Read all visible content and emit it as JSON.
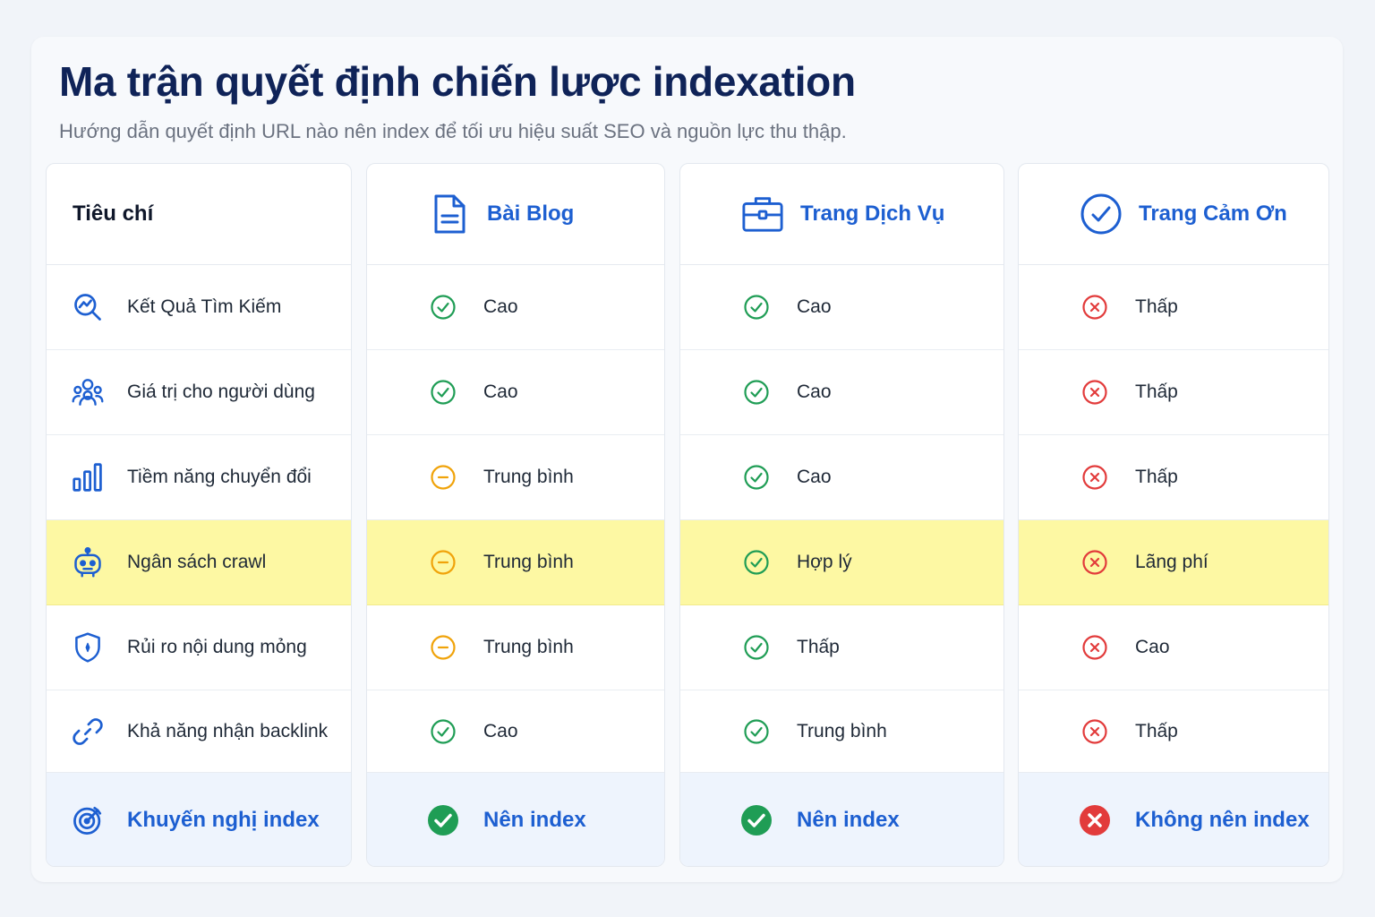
{
  "page": {
    "title": "Ma trận quyết định chiến lược indexation",
    "subtitle": "Hướng dẫn quyết định URL nào nên index để tối ưu hiệu suất SEO và nguồn lực thu thập."
  },
  "colors": {
    "good": "#1f9d55",
    "medium": "#f0a30a",
    "bad": "#e23b3b",
    "accent": "#1d5fd1",
    "highlight": "#fdf8a3",
    "recommend_bg": "#eef4fd"
  },
  "criteria": {
    "header": "Tiêu chí",
    "rows": [
      {
        "label": "Kết Quả Tìm Kiếm",
        "icon": "search-chart-icon"
      },
      {
        "label": "Giá trị cho người dùng",
        "icon": "users-icon"
      },
      {
        "label": "Tiềm năng chuyển đổi",
        "icon": "bar-chart-icon"
      },
      {
        "label": "Ngân sách crawl",
        "icon": "robot-icon"
      },
      {
        "label": "Rủi ro nội dung mỏng",
        "icon": "shield-icon"
      },
      {
        "label": "Khả năng nhận backlink",
        "icon": "link-icon"
      },
      {
        "label": "Khuyến nghị index",
        "icon": "target-icon"
      }
    ]
  },
  "columns": [
    {
      "header": "Bài Blog",
      "icon": "document-icon",
      "cells": [
        {
          "value": "Cao",
          "status": "good"
        },
        {
          "value": "Cao",
          "status": "good"
        },
        {
          "value": "Trung bình",
          "status": "medium"
        },
        {
          "value": "Trung bình",
          "status": "medium"
        },
        {
          "value": "Trung bình",
          "status": "medium"
        },
        {
          "value": "Cao",
          "status": "good"
        }
      ],
      "recommendation": {
        "value": "Nên index",
        "status": "good"
      }
    },
    {
      "header": "Trang Dịch Vụ",
      "icon": "briefcase-icon",
      "cells": [
        {
          "value": "Cao",
          "status": "good"
        },
        {
          "value": "Cao",
          "status": "good"
        },
        {
          "value": "Cao",
          "status": "good"
        },
        {
          "value": "Hợp lý",
          "status": "good"
        },
        {
          "value": "Thấp",
          "status": "good"
        },
        {
          "value": "Trung bình",
          "status": "good"
        }
      ],
      "recommendation": {
        "value": "Nên index",
        "status": "good"
      }
    },
    {
      "header": "Trang Cảm Ơn",
      "icon": "check-circle-icon",
      "cells": [
        {
          "value": "Thấp",
          "status": "bad"
        },
        {
          "value": "Thấp",
          "status": "bad"
        },
        {
          "value": "Thấp",
          "status": "bad"
        },
        {
          "value": "Lãng phí",
          "status": "bad"
        },
        {
          "value": "Cao",
          "status": "bad"
        },
        {
          "value": "Thấp",
          "status": "bad"
        }
      ],
      "recommendation": {
        "value": "Không nên index",
        "status": "bad"
      }
    }
  ]
}
